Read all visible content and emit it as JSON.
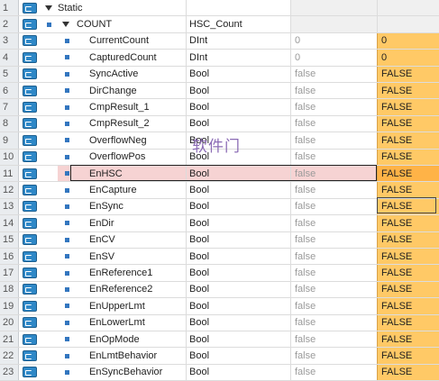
{
  "watermark": "软件门",
  "rows": [
    {
      "num": "1",
      "expander": true,
      "bullet": false,
      "name": "Static",
      "type": "",
      "start": "",
      "monitor": "",
      "header": true
    },
    {
      "num": "2",
      "expander": true,
      "bullet": true,
      "name": "COUNT",
      "type": "HSC_Count",
      "start": "",
      "monitor": "",
      "header": true
    },
    {
      "num": "3",
      "name": "CurrentCount",
      "type": "DInt",
      "start": "0",
      "monitor": "0"
    },
    {
      "num": "4",
      "name": "CapturedCount",
      "type": "DInt",
      "start": "0",
      "monitor": "0"
    },
    {
      "num": "5",
      "name": "SyncActive",
      "type": "Bool",
      "start": "false",
      "monitor": "FALSE"
    },
    {
      "num": "6",
      "name": "DirChange",
      "type": "Bool",
      "start": "false",
      "monitor": "FALSE"
    },
    {
      "num": "7",
      "name": "CmpResult_1",
      "type": "Bool",
      "start": "false",
      "monitor": "FALSE"
    },
    {
      "num": "8",
      "name": "CmpResult_2",
      "type": "Bool",
      "start": "false",
      "monitor": "FALSE"
    },
    {
      "num": "9",
      "name": "OverflowNeg",
      "type": "Bool",
      "start": "false",
      "monitor": "FALSE"
    },
    {
      "num": "10",
      "name": "OverflowPos",
      "type": "Bool",
      "start": "false",
      "monitor": "FALSE"
    },
    {
      "num": "11",
      "name": "EnHSC",
      "type": "Bool",
      "start": "false",
      "monitor": "FALSE",
      "selected": true
    },
    {
      "num": "12",
      "name": "EnCapture",
      "type": "Bool",
      "start": "false",
      "monitor": "FALSE"
    },
    {
      "num": "13",
      "name": "EnSync",
      "type": "Bool",
      "start": "false",
      "monitor": "FALSE"
    },
    {
      "num": "14",
      "name": "EnDir",
      "type": "Bool",
      "start": "false",
      "monitor": "FALSE"
    },
    {
      "num": "15",
      "name": "EnCV",
      "type": "Bool",
      "start": "false",
      "monitor": "FALSE"
    },
    {
      "num": "16",
      "name": "EnSV",
      "type": "Bool",
      "start": "false",
      "monitor": "FALSE"
    },
    {
      "num": "17",
      "name": "EnReference1",
      "type": "Bool",
      "start": "false",
      "monitor": "FALSE"
    },
    {
      "num": "18",
      "name": "EnReference2",
      "type": "Bool",
      "start": "false",
      "monitor": "FALSE"
    },
    {
      "num": "19",
      "name": "EnUpperLmt",
      "type": "Bool",
      "start": "false",
      "monitor": "FALSE"
    },
    {
      "num": "20",
      "name": "EnLowerLmt",
      "type": "Bool",
      "start": "false",
      "monitor": "FALSE"
    },
    {
      "num": "21",
      "name": "EnOpMode",
      "type": "Bool",
      "start": "false",
      "monitor": "FALSE"
    },
    {
      "num": "22",
      "name": "EnLmtBehavior",
      "type": "Bool",
      "start": "false",
      "monitor": "FALSE"
    },
    {
      "num": "23",
      "name": "EnSyncBehavior",
      "type": "Bool",
      "start": "false",
      "monitor": "FALSE"
    }
  ],
  "icons": {
    "row": "db-tag-icon",
    "bullet": "member-bullet-icon",
    "expander": "collapse-triangle-icon"
  },
  "colors": {
    "monitor_bg": "#ffc966",
    "selected_row": "#f6d3d3",
    "accent": "#2f88c7"
  }
}
